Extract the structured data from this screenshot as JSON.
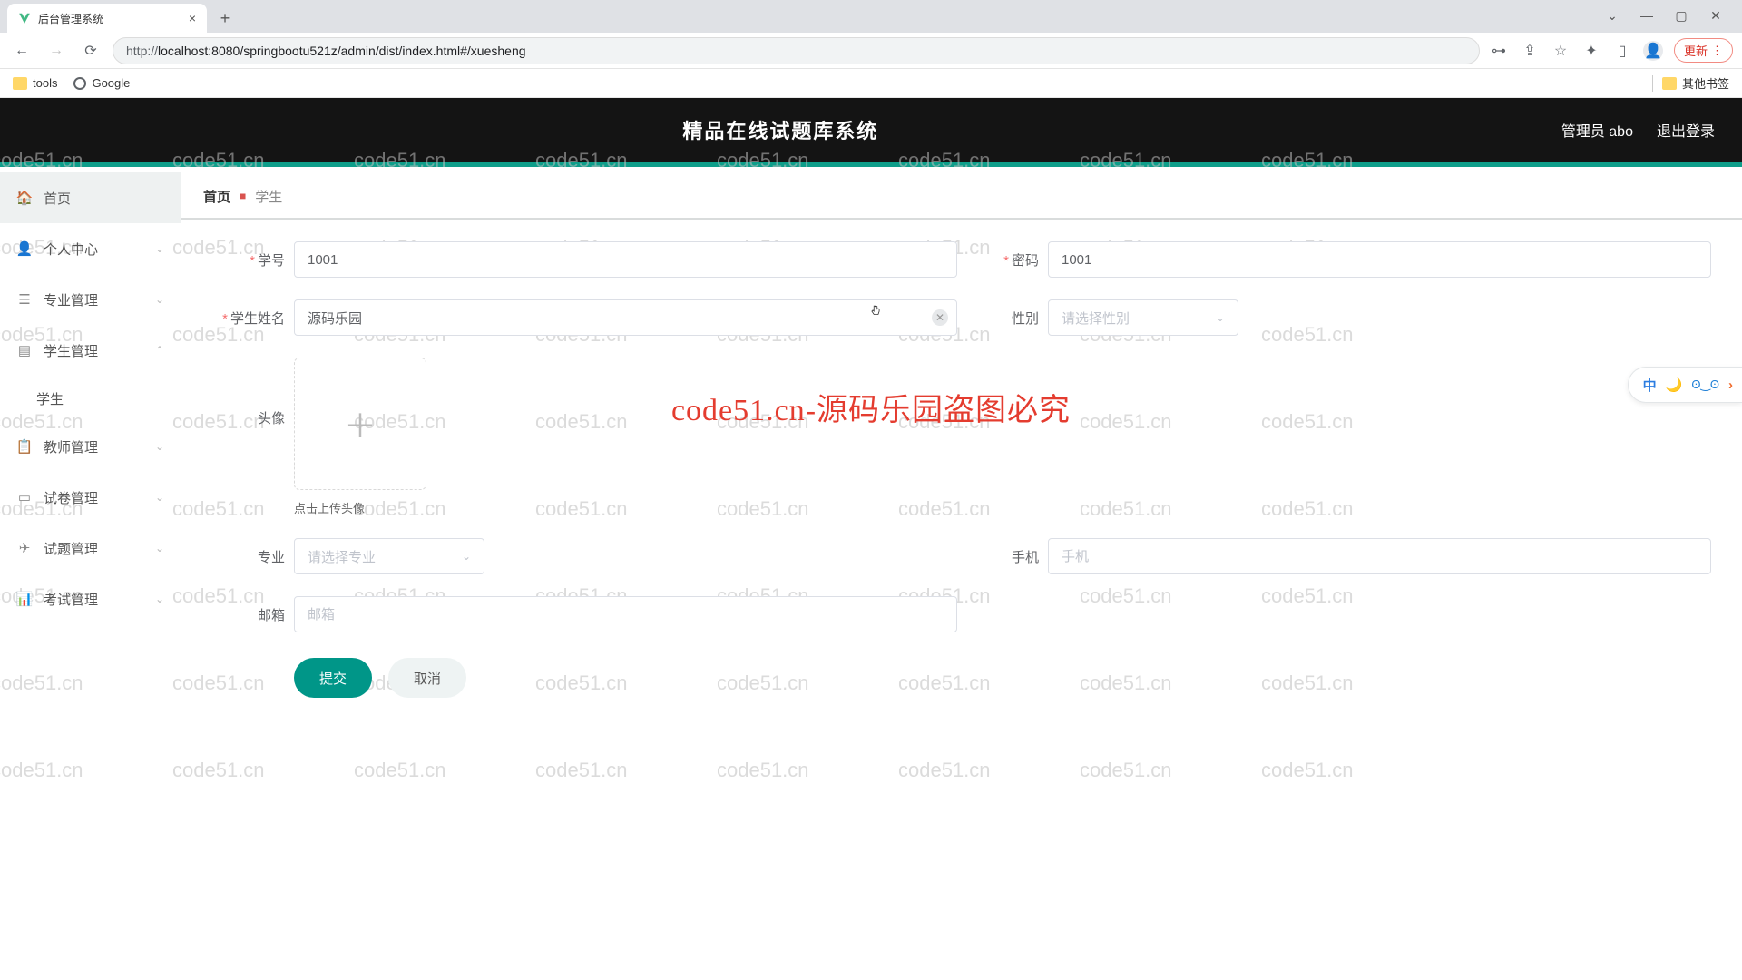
{
  "browser": {
    "tab_title": "后台管理系统",
    "url_protocol": "http://",
    "url_rest": "localhost:8080/springbootu521z/admin/dist/index.html#/xuesheng",
    "update_label": "更新",
    "bookmarks": {
      "tools": "tools",
      "google": "Google",
      "other": "其他书签"
    }
  },
  "header": {
    "title": "精品在线试题库系统",
    "user_label": "管理员 abo",
    "logout": "退出登录"
  },
  "sidebar": {
    "items": [
      {
        "label": "首页",
        "icon": "home"
      },
      {
        "label": "个人中心",
        "icon": "user",
        "chev": "down"
      },
      {
        "label": "专业管理",
        "icon": "stack",
        "chev": "down"
      },
      {
        "label": "学生管理",
        "icon": "layers",
        "chev": "up"
      },
      {
        "label": "教师管理",
        "icon": "list",
        "chev": "down"
      },
      {
        "label": "试卷管理",
        "icon": "doc",
        "chev": "down"
      },
      {
        "label": "试题管理",
        "icon": "send",
        "chev": "down"
      },
      {
        "label": "考试管理",
        "icon": "bar",
        "chev": "down"
      }
    ],
    "sub_student": "学生"
  },
  "breadcrumb": {
    "home": "首页",
    "current": "学生"
  },
  "form": {
    "student_no": {
      "label": "学号",
      "value": "1001"
    },
    "password": {
      "label": "密码",
      "value": "1001"
    },
    "name": {
      "label": "学生姓名",
      "value": "源码乐园"
    },
    "gender": {
      "label": "性别",
      "placeholder": "请选择性别"
    },
    "avatar": {
      "label": "头像",
      "hint": "点击上传头像"
    },
    "major": {
      "label": "专业",
      "placeholder": "请选择专业"
    },
    "phone": {
      "label": "手机",
      "placeholder": "手机"
    },
    "email": {
      "label": "邮箱",
      "placeholder": "邮箱"
    },
    "submit": "提交",
    "cancel": "取消"
  },
  "watermark_text": "code51.cn",
  "banner_text": "code51.cn-源码乐园盗图必究",
  "float_widget": {
    "lang": "中",
    "moon": "🌙",
    "eye": "👁",
    "arrow": "›"
  }
}
